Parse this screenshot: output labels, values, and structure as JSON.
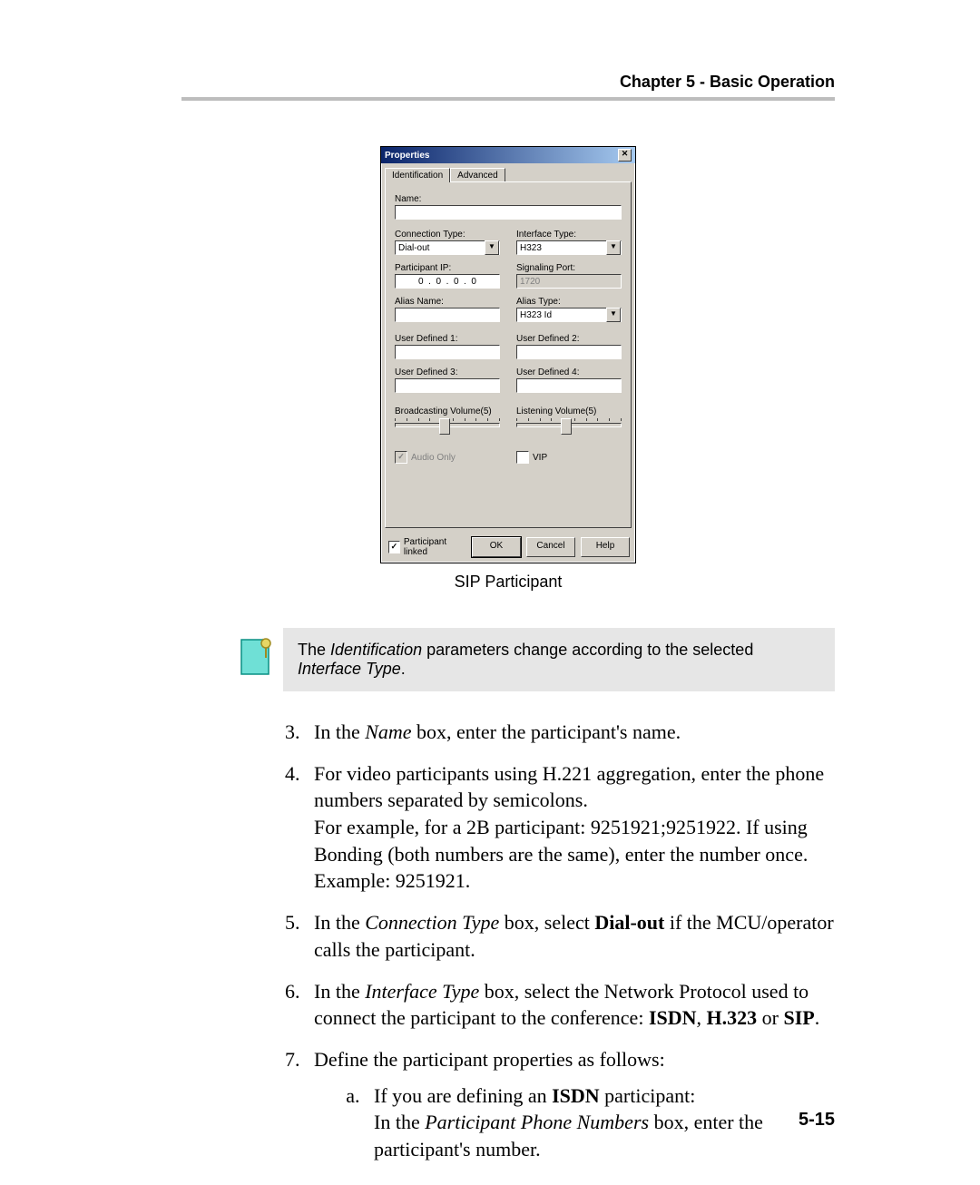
{
  "header": {
    "chapter": "Chapter 5 - Basic Operation"
  },
  "dialog": {
    "title": "Properties",
    "close_glyph": "✕",
    "tabs": {
      "identification": "Identification",
      "advanced": "Advanced"
    },
    "labels": {
      "name": "Name:",
      "connection_type": "Connection Type:",
      "interface_type": "Interface Type:",
      "participant_ip": "Participant IP:",
      "signaling_port": "Signaling Port:",
      "alias_name": "Alias Name:",
      "alias_type": "Alias Type:",
      "ud1": "User Defined 1:",
      "ud2": "User Defined 2:",
      "ud3": "User Defined 3:",
      "ud4": "User Defined 4:",
      "broadcast_vol": "Broadcasting Volume(5)",
      "listen_vol": "Listening Volume(5)"
    },
    "values": {
      "name": "",
      "connection_type": "Dial-out",
      "interface_type": "H323",
      "participant_ip": "0  .  0  .  0  .  0",
      "signaling_port": "1720",
      "alias_name": "",
      "alias_type": "H323 Id",
      "ud1": "",
      "ud2": "",
      "ud3": "",
      "ud4": ""
    },
    "checks": {
      "audio_only": "Audio Only",
      "audio_only_checked": "✓",
      "vip": "VIP",
      "participant_linked": "Participant linked",
      "participant_linked_checked": "✓"
    },
    "buttons": {
      "ok": "OK",
      "cancel": "Cancel",
      "help": "Help"
    },
    "dropdown_glyph": "▼"
  },
  "caption": "SIP Participant",
  "note": {
    "text_pre": "The ",
    "text_em1": "Identification",
    "text_mid": " parameters change according to the selected ",
    "text_em2": "Interface Type",
    "text_post": "."
  },
  "steps": {
    "s3_pre": "In the ",
    "s3_em": "Name",
    "s3_post": " box, enter the participant's name.",
    "s4_a": "For video participants using H.221 aggregation, enter the phone numbers separated by semicolons.",
    "s4_b": "For example, for a 2B participant: 9251921;9251922. If using Bonding (both numbers are the same), enter the number once. Example: 9251921.",
    "s5_pre": "In the ",
    "s5_em": "Connection Type",
    "s5_mid": " box, select ",
    "s5_b": "Dial-out",
    "s5_post": " if the MCU/operator calls the participant.",
    "s6_pre": "In the ",
    "s6_em": "Interface Type",
    "s6_mid": " box, select the Network Protocol used to connect the participant to the conference: ",
    "s6_b1": "ISDN",
    "s6_sep1": ", ",
    "s6_b2": "H.323",
    "s6_sep2": " or ",
    "s6_b3": "SIP",
    "s6_post": ".",
    "s7": "Define the participant properties as follows:",
    "s7a_pre": "If you are defining an ",
    "s7a_b": "ISDN",
    "s7a_mid": " participant:",
    "s7a_l2_pre": "In the ",
    "s7a_l2_em": "Participant Phone Numbers",
    "s7a_l2_post": " box, enter the participant's number."
  },
  "page_number": "5-15"
}
